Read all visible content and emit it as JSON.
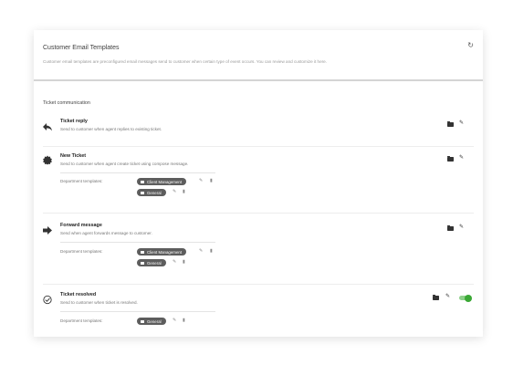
{
  "header": {
    "title": "Customer Email Templates",
    "subtitle": "Customer email templates are preconfigured email messages send to customer when certain type of event occurs. You can review and customize it here.",
    "refresh_icon": "refresh-icon"
  },
  "section": {
    "label": "Ticket communication"
  },
  "templates": [
    {
      "icon": "reply-icon",
      "title": "Ticket reply",
      "description": "Send to customer when agent replies to existing ticket."
    },
    {
      "icon": "badge-icon",
      "title": "New Ticket",
      "description": "Send to customer when agent create ticket using compose message.",
      "dept_label": "Department templates:",
      "chips": [
        "Client Management",
        "General"
      ]
    },
    {
      "icon": "forward-icon",
      "title": "Forward message",
      "description": "Send when agent forwards message to customer.",
      "dept_label": "Department templates:",
      "chips": [
        "Client Management",
        "General"
      ]
    },
    {
      "icon": "check-circle-icon",
      "title": "Ticket resolved",
      "description": "Send to customer when ticket is resolved.",
      "dept_label": "Department templates:",
      "chips": [
        "General"
      ],
      "enabled": true
    }
  ],
  "colors": {
    "chip_bg": "#5d5d5d",
    "toggle_on": "#3aa835"
  }
}
